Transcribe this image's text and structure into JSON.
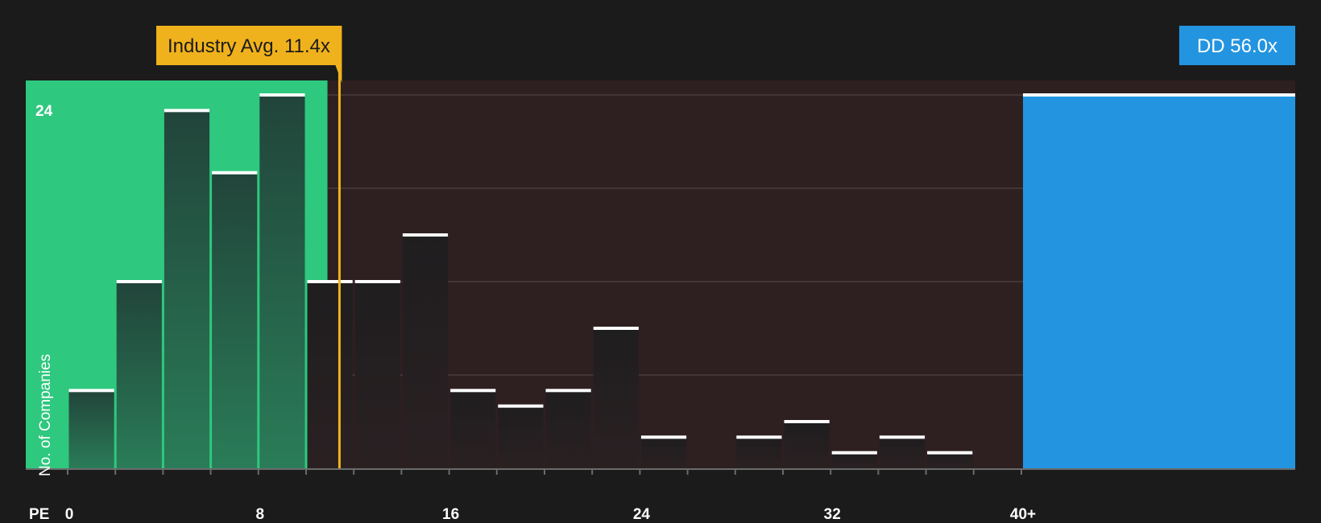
{
  "chart_data": {
    "type": "bar",
    "x_axis_prefix": "PE",
    "ylabel": "No. of Companies",
    "xlim": [
      0,
      41
    ],
    "ylim": [
      0,
      24
    ],
    "x_ticks": [
      {
        "value": 0,
        "label": "0"
      },
      {
        "value": 8,
        "label": "8"
      },
      {
        "value": 16,
        "label": "16"
      },
      {
        "value": 24,
        "label": "24"
      },
      {
        "value": 32,
        "label": "32"
      },
      {
        "value": 40,
        "label": "40+"
      }
    ],
    "y_tick_label": {
      "value": 24,
      "label": "24"
    },
    "gridlines_y": [
      6,
      12,
      18,
      24
    ],
    "bin_width": 2,
    "bins": [
      {
        "start": 0,
        "value": 5
      },
      {
        "start": 2,
        "value": 12
      },
      {
        "start": 4,
        "value": 23
      },
      {
        "start": 6,
        "value": 19
      },
      {
        "start": 8,
        "value": 24
      },
      {
        "start": 10,
        "value": 12
      },
      {
        "start": 12,
        "value": 12
      },
      {
        "start": 14,
        "value": 15
      },
      {
        "start": 16,
        "value": 5
      },
      {
        "start": 18,
        "value": 4
      },
      {
        "start": 20,
        "value": 5
      },
      {
        "start": 22,
        "value": 9
      },
      {
        "start": 24,
        "value": 2
      },
      {
        "start": 26,
        "value": 0
      },
      {
        "start": 28,
        "value": 2
      },
      {
        "start": 30,
        "value": 3
      },
      {
        "start": 32,
        "value": 1
      },
      {
        "start": 34,
        "value": 2
      },
      {
        "start": 36,
        "value": 1
      },
      {
        "start": 38,
        "value": 0
      }
    ],
    "highlight": {
      "label": "DD 56.0x",
      "value": 24,
      "x": 40,
      "color": "#2394e0"
    },
    "industry_avg": {
      "label": "Industry Avg. 11.4x",
      "value": 11.4,
      "color": "#f0b21c"
    },
    "colors": {
      "below_region": "#2ec87e",
      "above_region": "#2e1f20",
      "bar_in_below": "#24473a",
      "bar_in_above": "#221f20",
      "bar_cap": "#ffffff",
      "grid": "#4a3b3c"
    }
  }
}
